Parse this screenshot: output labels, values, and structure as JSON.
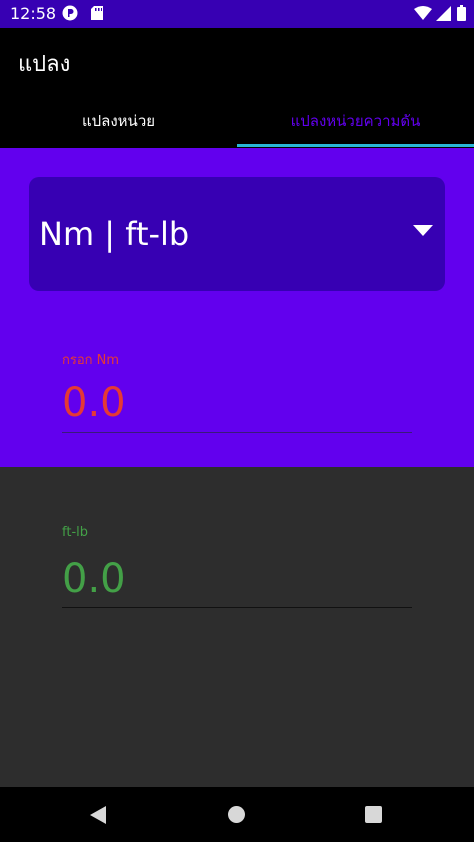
{
  "status_bar": {
    "time": "12:58",
    "left_icons": [
      "parking-notification-icon",
      "sd-card-icon"
    ],
    "right_icons": [
      "wifi-icon",
      "signal-icon",
      "battery-icon"
    ]
  },
  "app_bar": {
    "title": "แปลง"
  },
  "tabs": [
    {
      "label": "แปลงหน่วย",
      "selected": false
    },
    {
      "label": "แปลงหน่วยความดัน",
      "selected": true
    }
  ],
  "converter": {
    "unit_pair": "Nm | ft-lb",
    "input": {
      "label": "กรอก Nm",
      "value": "0.0"
    },
    "output": {
      "label": "ft-lb",
      "value": "0.0"
    }
  },
  "colors": {
    "status_bar": "#3700b3",
    "primary": "#6200ee",
    "spinner_bg": "#3700b3",
    "tab_indicator": "#29b6d6",
    "input_text": "#e53935",
    "output_text": "#43a047",
    "output_bg": "#2d2d2d"
  },
  "nav_bar": {
    "icons": [
      "back-icon",
      "home-icon",
      "recents-icon"
    ]
  }
}
